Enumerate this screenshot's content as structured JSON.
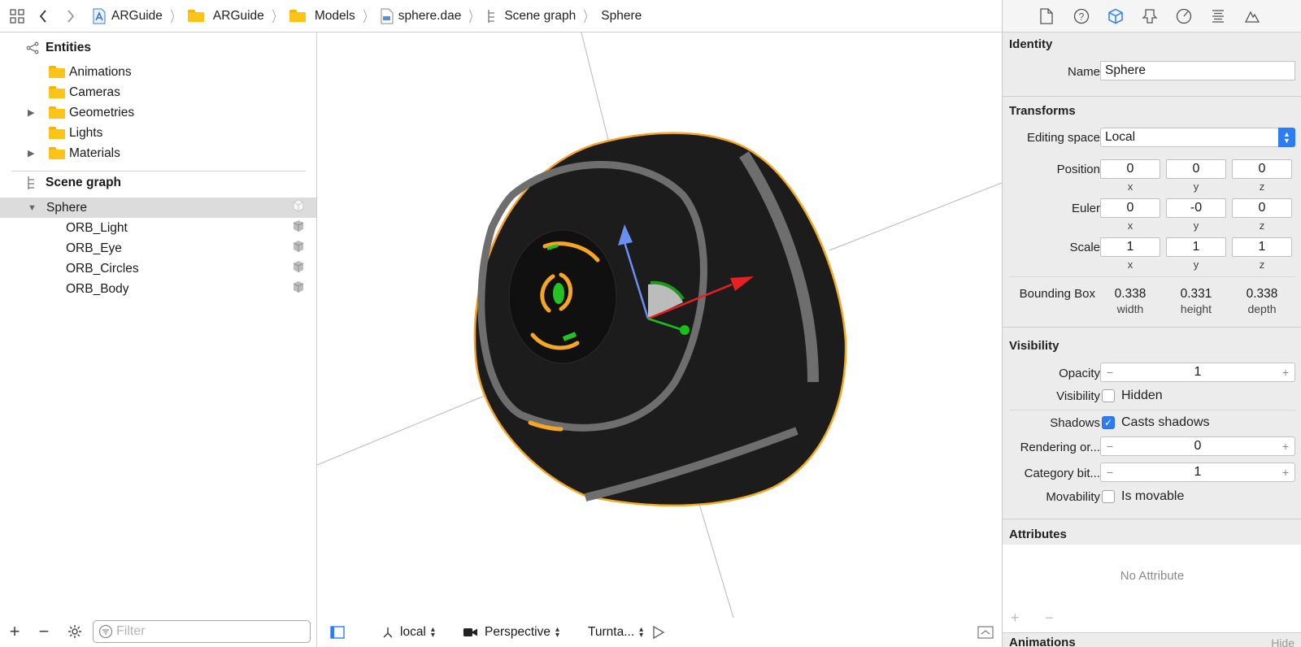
{
  "breadcrumb": [
    {
      "label": "ARGuide",
      "icon": "project-icon"
    },
    {
      "label": "ARGuide",
      "icon": "folder-icon"
    },
    {
      "label": "Models",
      "icon": "folder-icon"
    },
    {
      "label": "sphere.dae",
      "icon": "dae-file-icon"
    },
    {
      "label": "Scene graph",
      "icon": "scene-graph-icon"
    },
    {
      "label": "Sphere",
      "icon": ""
    }
  ],
  "sidebar": {
    "entities_title": "Entities",
    "entities": [
      "Animations",
      "Cameras",
      "Geometries",
      "Lights",
      "Materials"
    ],
    "scene_graph_title": "Scene graph",
    "root_node": "Sphere",
    "children": [
      "ORB_Light",
      "ORB_Eye",
      "ORB_Circles",
      "ORB_Body"
    ],
    "filter_placeholder": "Filter"
  },
  "viewport_footer": {
    "space": "local",
    "camera": "Perspective",
    "mode": "Turnta..."
  },
  "inspector": {
    "identity": {
      "title": "Identity",
      "name_label": "Name",
      "name_value": "Sphere"
    },
    "transforms": {
      "title": "Transforms",
      "editing_space_label": "Editing space",
      "editing_space_value": "Local",
      "axis_x": "x",
      "axis_y": "y",
      "axis_z": "z",
      "position_label": "Position",
      "position": [
        "0",
        "0",
        "0"
      ],
      "euler_label": "Euler",
      "euler": [
        "0",
        "-0",
        "0"
      ],
      "scale_label": "Scale",
      "scale": [
        "1",
        "1",
        "1"
      ],
      "bbox_label": "Bounding Box",
      "bbox": [
        "0.338",
        "0.331",
        "0.338"
      ],
      "bbox_sub": [
        "width",
        "height",
        "depth"
      ]
    },
    "visibility": {
      "title": "Visibility",
      "opacity_label": "Opacity",
      "opacity_value": "1",
      "visibility_label": "Visibility",
      "hidden_label": "Hidden",
      "shadows_label": "Shadows",
      "casts_shadows_label": "Casts shadows",
      "rendering_label": "Rendering or...",
      "rendering_value": "0",
      "category_label": "Category bit...",
      "category_value": "1",
      "movability_label": "Movability",
      "movable_label": "Is movable"
    },
    "attributes": {
      "title": "Attributes",
      "empty": "No Attribute"
    },
    "animations": {
      "title": "Animations",
      "hide": "Hide"
    }
  }
}
